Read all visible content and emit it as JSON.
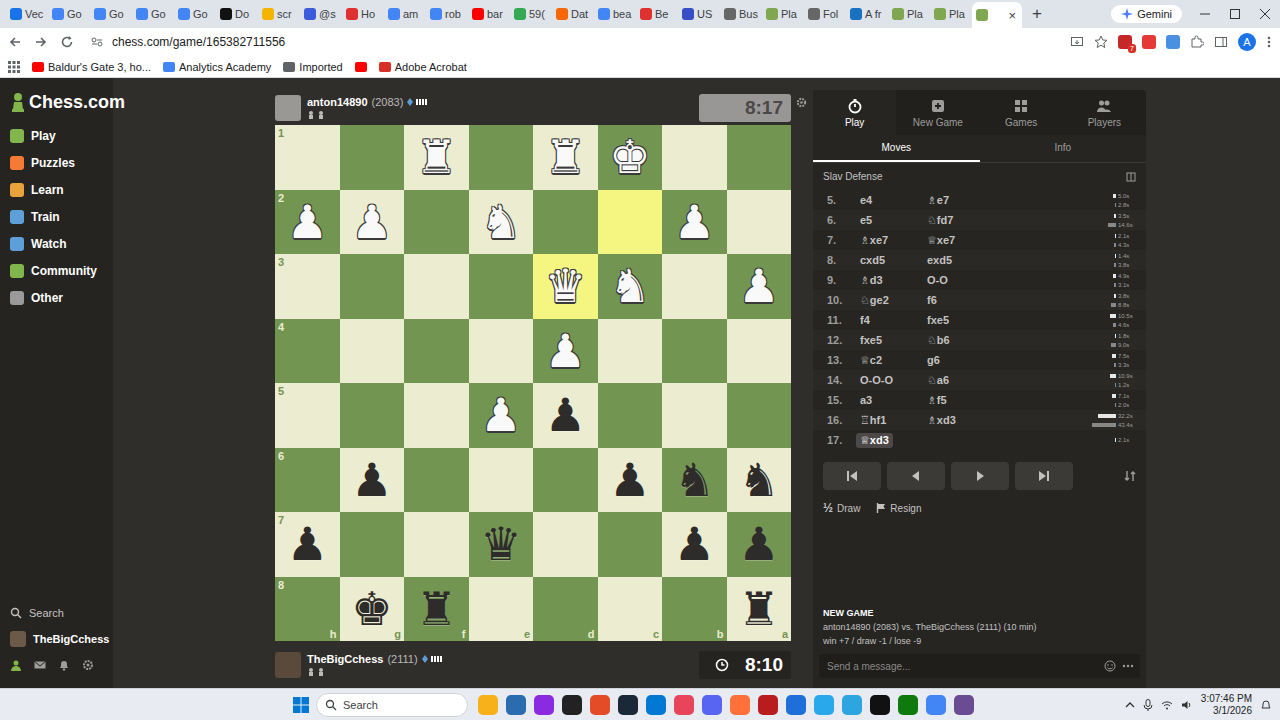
{
  "browser": {
    "tabs": [
      {
        "label": "Vec",
        "color": "#1a73e8",
        "selected": false
      },
      {
        "label": "Go",
        "color": "#4285f4",
        "selected": false
      },
      {
        "label": "Go",
        "color": "#4285f4",
        "selected": false
      },
      {
        "label": "Go",
        "color": "#4285f4",
        "selected": false
      },
      {
        "label": "Go",
        "color": "#4285f4",
        "selected": false
      },
      {
        "label": "Do",
        "color": "#111111",
        "selected": false
      },
      {
        "label": "scr",
        "color": "#f4b400",
        "selected": false
      },
      {
        "label": "@s",
        "color": "#3b5bdb",
        "selected": false
      },
      {
        "label": "Ho",
        "color": "#e03131",
        "selected": false
      },
      {
        "label": "am",
        "color": "#4285f4",
        "selected": false
      },
      {
        "label": "rob",
        "color": "#4285f4",
        "selected": false
      },
      {
        "label": "bar",
        "color": "#ff0000",
        "selected": false
      },
      {
        "label": "59(",
        "color": "#34a853",
        "selected": false
      },
      {
        "label": "Dat",
        "color": "#f76707",
        "selected": false
      },
      {
        "label": "bea",
        "color": "#4285f4",
        "selected": false
      },
      {
        "label": "Be",
        "color": "#e03131",
        "selected": false
      },
      {
        "label": "US",
        "color": "#364fc7",
        "selected": false
      },
      {
        "label": "Bus",
        "color": "#666666",
        "selected": false
      },
      {
        "label": "Pla",
        "color": "#7fa650",
        "selected": false
      },
      {
        "label": "Fol",
        "color": "#666666",
        "selected": false
      },
      {
        "label": "A fr",
        "color": "#1971c2",
        "selected": false
      },
      {
        "label": "Pla",
        "color": "#7fa650",
        "selected": false
      },
      {
        "label": "Pla",
        "color": "#7fa650",
        "selected": false
      },
      {
        "label": "",
        "color": "#7fa650",
        "selected": true
      }
    ],
    "close_tab": "×",
    "new_tab": "+",
    "gemini": "Gemini",
    "url": "chess.com/game/165382711556",
    "extension_badge": "7",
    "profile": "A",
    "bookmarks": [
      {
        "label": "Baldur's Gate 3, ho...",
        "color": "#ff0000"
      },
      {
        "label": "Analytics Academy",
        "color": "#4285f4"
      },
      {
        "label": "Imported",
        "color": "#5f6368"
      },
      {
        "label": "",
        "color": "#ff0000"
      },
      {
        "label": "Adobe Acrobat",
        "color": "#d93025"
      }
    ]
  },
  "sidebar": {
    "logo": "Chess.com",
    "items": [
      {
        "label": "Play",
        "color": "#81b64c"
      },
      {
        "label": "Puzzles",
        "color": "#f47a36"
      },
      {
        "label": "Learn",
        "color": "#e8a33d"
      },
      {
        "label": "Train",
        "color": "#5d9fd8"
      },
      {
        "label": "Watch",
        "color": "#5d9fd8"
      },
      {
        "label": "Community",
        "color": "#81b64c"
      },
      {
        "label": "Other",
        "color": "#9a9a9a"
      }
    ],
    "search": "Search",
    "user": "TheBigCchess"
  },
  "top_player": {
    "name": "anton14890",
    "rating": "(2083)",
    "clock": "8:17",
    "running": false
  },
  "bottom_player": {
    "name": "TheBigCchess",
    "rating": "(2111)",
    "clock": "8:10",
    "running": true
  },
  "board": {
    "ranks": [
      "1",
      "2",
      "3",
      "4",
      "5",
      "6",
      "7",
      "8"
    ],
    "files": [
      "h",
      "g",
      "f",
      "e",
      "d",
      "c",
      "b",
      "a"
    ],
    "rows": [
      [
        {
          "piece": "",
          "side": "",
          "highlighted": false
        },
        {
          "piece": "",
          "side": "",
          "highlighted": false
        },
        {
          "piece": "♜",
          "side": "white",
          "highlighted": false
        },
        {
          "piece": "",
          "side": "",
          "highlighted": false
        },
        {
          "piece": "♜",
          "side": "white",
          "highlighted": false
        },
        {
          "piece": "♚",
          "side": "white",
          "highlighted": false
        },
        {
          "piece": "",
          "side": "",
          "highlighted": false
        },
        {
          "piece": "",
          "side": "",
          "highlighted": false
        }
      ],
      [
        {
          "piece": "♟",
          "side": "white",
          "highlighted": false
        },
        {
          "piece": "♟",
          "side": "white",
          "highlighted": false
        },
        {
          "piece": "",
          "side": "",
          "highlighted": false
        },
        {
          "piece": "♞",
          "side": "white",
          "highlighted": false
        },
        {
          "piece": "",
          "side": "",
          "highlighted": false
        },
        {
          "piece": "",
          "side": "",
          "highlighted": true
        },
        {
          "piece": "♟",
          "side": "white",
          "highlighted": false
        },
        {
          "piece": "",
          "side": "",
          "highlighted": false
        }
      ],
      [
        {
          "piece": "",
          "side": "",
          "highlighted": false
        },
        {
          "piece": "",
          "side": "",
          "highlighted": false
        },
        {
          "piece": "",
          "side": "",
          "highlighted": false
        },
        {
          "piece": "",
          "side": "",
          "highlighted": false
        },
        {
          "piece": "♛",
          "side": "white",
          "highlighted": true
        },
        {
          "piece": "♞",
          "side": "white",
          "highlighted": false
        },
        {
          "piece": "",
          "side": "",
          "highlighted": false
        },
        {
          "piece": "♟",
          "side": "white",
          "highlighted": false
        }
      ],
      [
        {
          "piece": "",
          "side": "",
          "highlighted": false
        },
        {
          "piece": "",
          "side": "",
          "highlighted": false
        },
        {
          "piece": "",
          "side": "",
          "highlighted": false
        },
        {
          "piece": "",
          "side": "",
          "highlighted": false
        },
        {
          "piece": "♟",
          "side": "white",
          "highlighted": false
        },
        {
          "piece": "",
          "side": "",
          "highlighted": false
        },
        {
          "piece": "",
          "side": "",
          "highlighted": false
        },
        {
          "piece": "",
          "side": "",
          "highlighted": false
        }
      ],
      [
        {
          "piece": "",
          "side": "",
          "highlighted": false
        },
        {
          "piece": "",
          "side": "",
          "highlighted": false
        },
        {
          "piece": "",
          "side": "",
          "highlighted": false
        },
        {
          "piece": "♟",
          "side": "white",
          "highlighted": false
        },
        {
          "piece": "♟",
          "side": "black",
          "highlighted": false
        },
        {
          "piece": "",
          "side": "",
          "highlighted": false
        },
        {
          "piece": "",
          "side": "",
          "highlighted": false
        },
        {
          "piece": "",
          "side": "",
          "highlighted": false
        }
      ],
      [
        {
          "piece": "",
          "side": "",
          "highlighted": false
        },
        {
          "piece": "♟",
          "side": "black",
          "highlighted": false
        },
        {
          "piece": "",
          "side": "",
          "highlighted": false
        },
        {
          "piece": "",
          "side": "",
          "highlighted": false
        },
        {
          "piece": "",
          "side": "",
          "highlighted": false
        },
        {
          "piece": "♟",
          "side": "black",
          "highlighted": false
        },
        {
          "piece": "♞",
          "side": "black",
          "highlighted": false
        },
        {
          "piece": "♞",
          "side": "black",
          "highlighted": false
        }
      ],
      [
        {
          "piece": "♟",
          "side": "black",
          "highlighted": false
        },
        {
          "piece": "",
          "side": "",
          "highlighted": false
        },
        {
          "piece": "",
          "side": "",
          "highlighted": false
        },
        {
          "piece": "♛",
          "side": "black",
          "highlighted": false
        },
        {
          "piece": "",
          "side": "",
          "highlighted": false
        },
        {
          "piece": "",
          "side": "",
          "highlighted": false
        },
        {
          "piece": "♟",
          "side": "black",
          "highlighted": false
        },
        {
          "piece": "♟",
          "side": "black",
          "highlighted": false
        }
      ],
      [
        {
          "piece": "",
          "side": "",
          "highlighted": false
        },
        {
          "piece": "♚",
          "side": "black",
          "highlighted": false
        },
        {
          "piece": "♜",
          "side": "black",
          "highlighted": false
        },
        {
          "piece": "",
          "side": "",
          "highlighted": false
        },
        {
          "piece": "",
          "side": "",
          "highlighted": false
        },
        {
          "piece": "",
          "side": "",
          "highlighted": false
        },
        {
          "piece": "",
          "side": "",
          "highlighted": false
        },
        {
          "piece": "♜",
          "side": "black",
          "highlighted": false
        }
      ]
    ]
  },
  "panel": {
    "tabs": [
      {
        "label": "Play",
        "selected": true
      },
      {
        "label": "New Game",
        "selected": false
      },
      {
        "label": "Games",
        "selected": false
      },
      {
        "label": "Players",
        "selected": false
      }
    ],
    "subtabs": [
      {
        "label": "Moves",
        "selected": true
      },
      {
        "label": "Info",
        "selected": false
      }
    ],
    "opening": "Slav Defense",
    "moves": [
      {
        "number": "5.",
        "white": "e4",
        "black": "♗e7",
        "white_time": "5.0s",
        "black_time": "2.8s",
        "white_level": 0.12,
        "black_level": 0.06,
        "white_current": false,
        "black_current": false
      },
      {
        "number": "6.",
        "white": "e5",
        "black": "♘fd7",
        "white_time": "3.5s",
        "black_time": "14.6s",
        "white_level": 0.08,
        "black_level": 0.34,
        "white_current": false,
        "black_current": false
      },
      {
        "number": "7.",
        "white": "♗xe7",
        "black": "♕xe7",
        "white_time": "2.1s",
        "black_time": "4.3s",
        "white_level": 0.05,
        "black_level": 0.1,
        "white_current": false,
        "black_current": false
      },
      {
        "number": "8.",
        "white": "cxd5",
        "black": "exd5",
        "white_time": "1.4s",
        "black_time": "3.8s",
        "white_level": 0.03,
        "black_level": 0.09,
        "white_current": false,
        "black_current": false
      },
      {
        "number": "9.",
        "white": "♗d3",
        "black": "O-O",
        "white_time": "4.9s",
        "black_time": "3.1s",
        "white_level": 0.11,
        "black_level": 0.07,
        "white_current": false,
        "black_current": false
      },
      {
        "number": "10.",
        "white": "♘ge2",
        "black": "f6",
        "white_time": "3.8s",
        "black_time": "8.8s",
        "white_level": 0.09,
        "black_level": 0.2,
        "white_current": false,
        "black_current": false
      },
      {
        "number": "11.",
        "white": "f4",
        "black": "fxe5",
        "white_time": "10.5s",
        "black_time": "4.6s",
        "white_level": 0.24,
        "black_level": 0.11,
        "white_current": false,
        "black_current": false
      },
      {
        "number": "12.",
        "white": "fxe5",
        "black": "♘b6",
        "white_time": "1.8s",
        "black_time": "9.0s",
        "white_level": 0.04,
        "black_level": 0.21,
        "white_current": false,
        "black_current": false
      },
      {
        "number": "13.",
        "white": "♕c2",
        "black": "g6",
        "white_time": "7.5s",
        "black_time": "3.3s",
        "white_level": 0.17,
        "black_level": 0.08,
        "white_current": false,
        "black_current": false
      },
      {
        "number": "14.",
        "white": "O-O-O",
        "black": "♘a6",
        "white_time": "10.9s",
        "black_time": "1.2s",
        "white_level": 0.25,
        "black_level": 0.03,
        "white_current": false,
        "black_current": false
      },
      {
        "number": "15.",
        "white": "a3",
        "black": "♗f5",
        "white_time": "7.1s",
        "black_time": "2.0s",
        "white_level": 0.16,
        "black_level": 0.05,
        "white_current": false,
        "black_current": false
      },
      {
        "number": "16.",
        "white": "♖hf1",
        "black": "♗xd3",
        "white_time": "32.2s",
        "black_time": "43.4s",
        "white_level": 0.74,
        "black_level": 1,
        "white_current": false,
        "black_current": false
      },
      {
        "number": "17.",
        "white": "♕xd3",
        "black": "",
        "white_time": "2.1s",
        "black_time": "",
        "white_level": 0.05,
        "black_level": 0,
        "white_current": true,
        "black_current": false
      }
    ],
    "draw_icon": "½",
    "draw": "Draw",
    "resign": "Resign",
    "info_title": "NEW GAME",
    "info_line": "anton14890 (2083) vs. TheBigCchess (2111) (10 min)",
    "info_score": "win +7 / draw -1 / lose -9",
    "message_placeholder": "Send a message..."
  },
  "taskbar": {
    "search": "Search",
    "time": "3:07:46 PM",
    "date": "3/1/2026",
    "apps": [
      {
        "color": "#f7b21b"
      },
      {
        "color": "#2b6cb0"
      },
      {
        "color": "#8a2be2"
      },
      {
        "color": "#222222"
      },
      {
        "color": "#e34c26"
      },
      {
        "color": "#1b2838"
      },
      {
        "color": "#0078d4"
      },
      {
        "color": "#e8455a"
      },
      {
        "color": "#5865f2"
      },
      {
        "color": "#ff7139"
      },
      {
        "color": "#b91c1c"
      },
      {
        "color": "#1e6fd9"
      },
      {
        "color": "#29a9eb"
      },
      {
        "color": "#2ca5e0"
      },
      {
        "color": "#111111"
      },
      {
        "color": "#0e7a0d"
      },
      {
        "color": "#4285f4"
      },
      {
        "color": "#6a4c93"
      }
    ]
  }
}
